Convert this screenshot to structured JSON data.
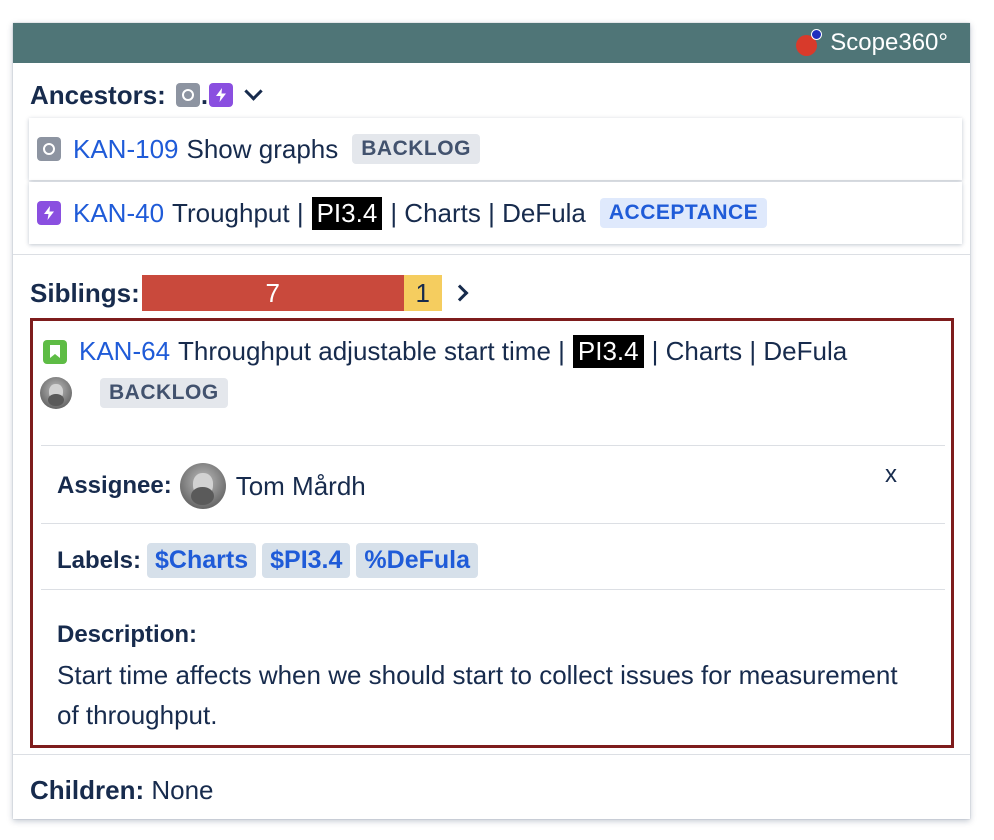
{
  "app": {
    "name": "Scope360°",
    "brand_color": "#4f7577"
  },
  "ancestors": {
    "label": "Ancestors:",
    "separator": ".",
    "icons": [
      "story-icon",
      "epic-icon"
    ],
    "items": [
      {
        "icon": "story-icon",
        "key": "KAN-109",
        "summary": "Show graphs",
        "status": "BACKLOG"
      },
      {
        "icon": "epic-icon",
        "key": "KAN-40",
        "summary_pre": "Troughput |",
        "tag": "PI3.4",
        "summary_post": "| Charts | DeFula",
        "status": "ACCEPTANCE"
      }
    ]
  },
  "siblings": {
    "label": "Siblings:",
    "bar": {
      "red_count": "7",
      "yellow_count": "1",
      "red_color": "#c9493c",
      "yellow_color": "#f5cd5f"
    }
  },
  "selected_issue": {
    "icon": "bookmark-icon",
    "key": "KAN-64",
    "summary_pre": "Throughput adjustable start time |",
    "tag": "PI3.4",
    "summary_post": "| Charts | DeFula",
    "status": "BACKLOG",
    "close_label": "x",
    "assignee_label": "Assignee:",
    "assignee_name": "Tom Mårdh",
    "labels_label": "Labels:",
    "labels": [
      "$Charts",
      "$PI3.4",
      "%DeFula"
    ],
    "description_label": "Description:",
    "description": "Start time affects when we should start to collect issues for measurement of throughput."
  },
  "children": {
    "label": "Children:",
    "value": "None"
  }
}
